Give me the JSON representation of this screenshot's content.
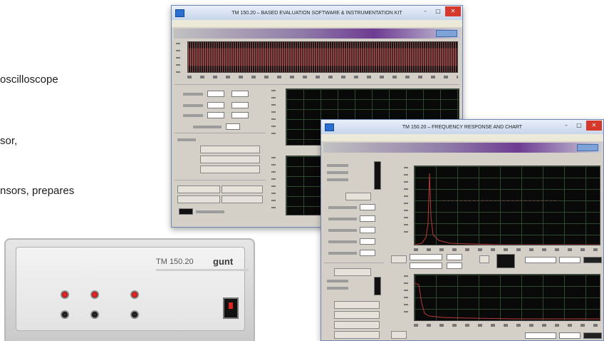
{
  "background_text": {
    "line1": "oscilloscope",
    "line2": "sor,",
    "line3": "nsors, prepares"
  },
  "device": {
    "model": "TM 150.20",
    "brand": "gunt"
  },
  "window1": {
    "title": "TM 150.20 – BASED EVALUATION SOFTWARE & INSTRUMENTATION KIT",
    "minimize": "–",
    "maximize": "□",
    "close": "✕",
    "icon": "app-icon"
  },
  "window2": {
    "title": "TM 150.20 – FREQUENCY RESPONSE AND CHART",
    "minimize": "–",
    "maximize": "□",
    "close": "✕",
    "icon": "app-icon"
  },
  "colors": {
    "title_gradient_start": "#e9f0fb",
    "title_gradient_end": "#c7d5ea",
    "close_button": "#d6392c",
    "banner_purple": "#6e3c92",
    "plot_background": "#090909",
    "grid_line": "#2e4a2e",
    "trace_red": "#b83a3a"
  }
}
